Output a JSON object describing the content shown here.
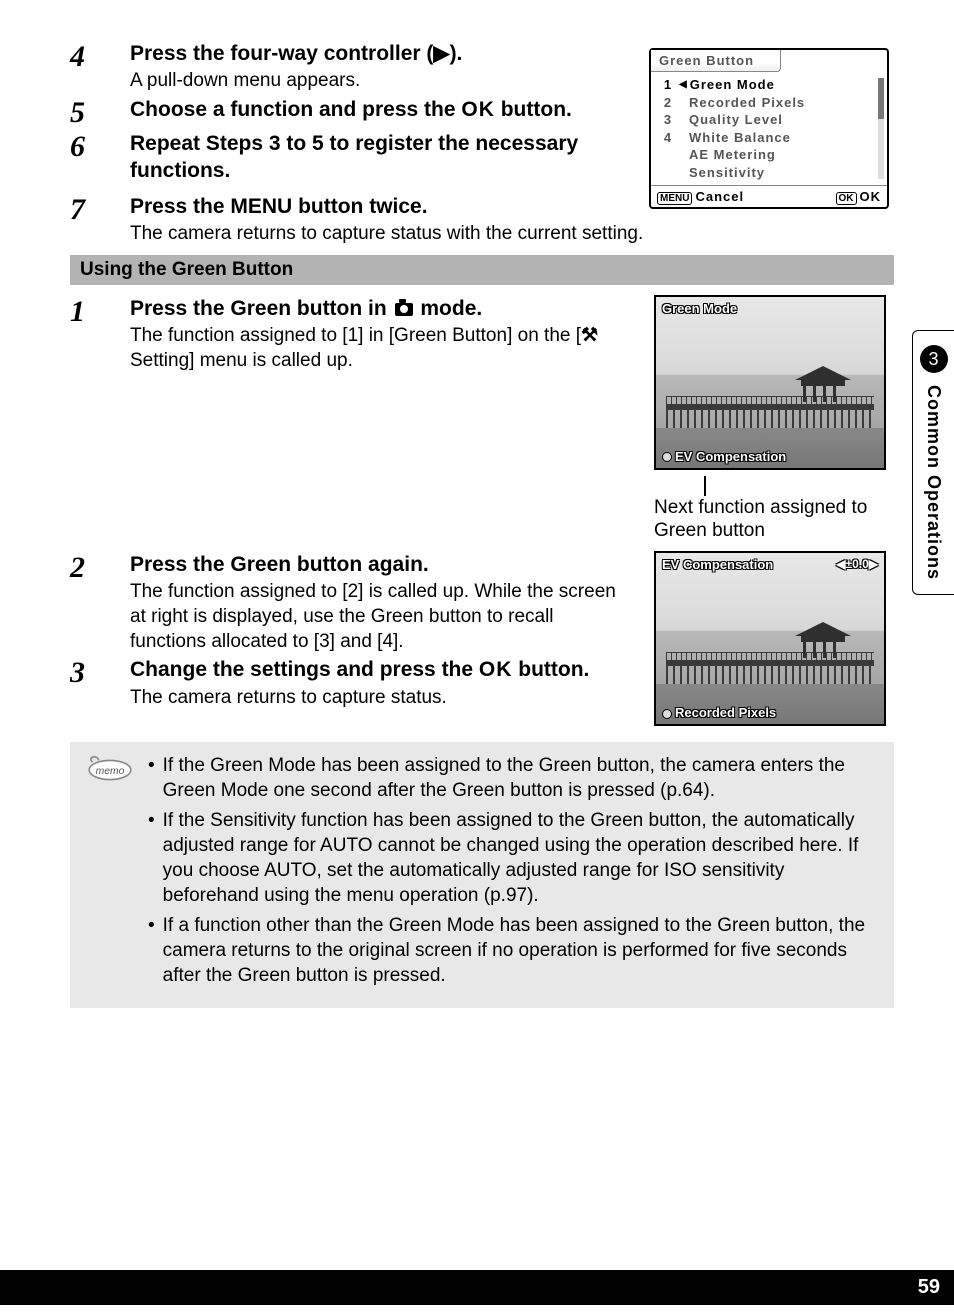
{
  "sideTab": {
    "chapterNum": "3",
    "chapterTitle": "Common Operations"
  },
  "pageNumber": "59",
  "menuMock": {
    "title": "Green Button",
    "rows": [
      {
        "idx": "1",
        "label": "Green Mode",
        "highlight": true
      },
      {
        "idx": "2",
        "label": "Recorded Pixels"
      },
      {
        "idx": "3",
        "label": "Quality Level"
      },
      {
        "idx": "4",
        "label": "White Balance"
      },
      {
        "idx": "",
        "label": "AE Metering"
      },
      {
        "idx": "",
        "label": "Sensitivity"
      }
    ],
    "footer": {
      "menuBtn": "MENU",
      "cancel": "Cancel",
      "okBtn": "OK",
      "ok": "OK"
    }
  },
  "stepsA": [
    {
      "num": "4",
      "title_pre": "Press the four-way controller (",
      "title_post": ").",
      "desc": "A pull-down menu appears."
    },
    {
      "num": "5",
      "title": "Choose a function and press the ",
      "ok": "OK",
      "title2": " button."
    },
    {
      "num": "6",
      "title": "Repeat Steps 3 to 5 to register the necessary functions."
    },
    {
      "num": "7",
      "title_pre": "Press the ",
      "menu": "MENU",
      "title_post": " button twice.",
      "desc": "The camera returns to capture status with the current setting."
    }
  ],
  "sectionHeader": "Using the Green Button",
  "stepsB": [
    {
      "num": "1",
      "title_pre": "Press the Green button in ",
      "title_post": " mode.",
      "desc_pre": "The function assigned to [1] in [Green Button] on the [",
      "wrench": "⚒",
      "desc_mid": " Setting] menu is called up."
    },
    {
      "num": "2",
      "title": "Press the Green button again.",
      "desc": "The function assigned to [2] is called up. While the screen at right is displayed, use the Green button to recall functions allocated to [3] and [4]."
    },
    {
      "num": "3",
      "title_pre": "Change the settings and press the ",
      "ok": "OK",
      "title_post": " button.",
      "desc": "The camera returns to capture status."
    }
  ],
  "camScreen1": {
    "top": "Green Mode",
    "bottom": "EV Compensation"
  },
  "camCaption": "Next function assigned to Green button",
  "camScreen2": {
    "top": "EV Compensation",
    "topright": "◀±0.0▶",
    "bottom": "Recorded Pixels"
  },
  "memo": {
    "label": "memo",
    "items": [
      "If the Green Mode has been assigned to the Green button, the camera enters the Green Mode one second after the Green button is pressed (p.64).",
      "If the Sensitivity function has been assigned to the Green button, the automatically adjusted range for AUTO cannot be changed using the operation described here. If you choose AUTO, set the automatically adjusted range for ISO sensitivity beforehand using the menu operation (p.97).",
      "If a function other than the Green Mode has been assigned to the Green button, the camera returns to the original screen if no operation is performed for five seconds after the Green button is pressed."
    ]
  }
}
